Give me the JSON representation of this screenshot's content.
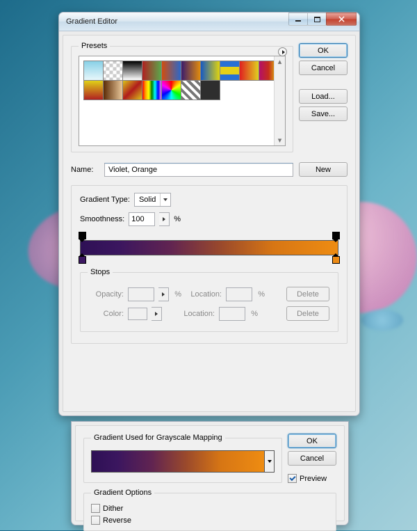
{
  "main": {
    "title": "Gradient Editor",
    "presetsLegend": "Presets",
    "buttons": {
      "ok": "OK",
      "cancel": "Cancel",
      "load": "Load...",
      "save": "Save...",
      "new": "New",
      "delete": "Delete"
    },
    "nameLabel": "Name:",
    "nameValue": "Violet, Orange",
    "gradTypeLabel": "Gradient Type:",
    "gradTypeValue": "Solid",
    "smoothLabel": "Smoothness:",
    "smoothValue": "100",
    "pct": "%",
    "stopsLegend": "Stops",
    "opacityLabel": "Opacity:",
    "locationLabel": "Location:",
    "colorLabel": "Color:"
  },
  "sub": {
    "gradUsedLegend": "Gradient Used for Grayscale Mapping",
    "optsLegend": "Gradient Options",
    "ok": "OK",
    "cancel": "Cancel",
    "preview": "Preview",
    "dither": "Dither",
    "reverse": "Reverse"
  }
}
